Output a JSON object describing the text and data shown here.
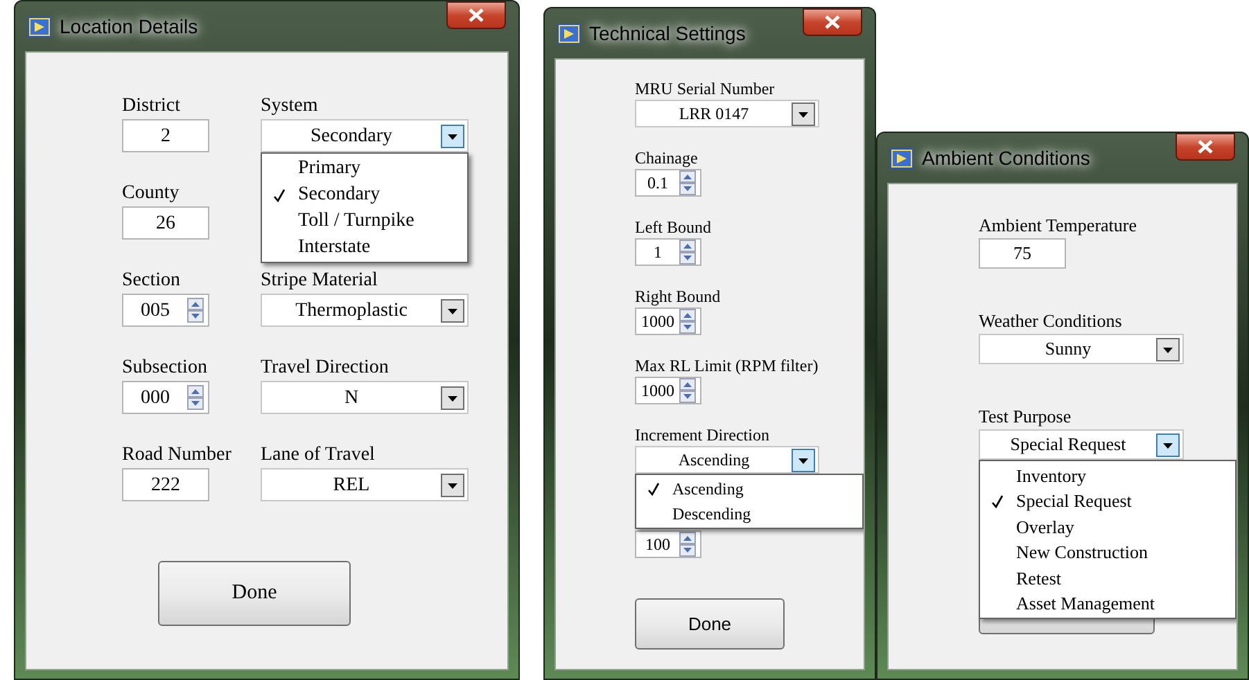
{
  "windows": [
    {
      "title": "Location Details",
      "rows": [
        {
          "left": {
            "kind": "text",
            "label": "District",
            "value": "2"
          },
          "right": {
            "kind": "dropdown",
            "label": "System",
            "value": "Secondary",
            "menu": [
              {
                "label": "Primary",
                "selected": false
              },
              {
                "label": "Secondary",
                "selected": true
              },
              {
                "label": "Toll / Turnpike",
                "selected": false
              },
              {
                "label": "Interstate",
                "selected": false
              }
            ]
          }
        },
        {
          "left": {
            "kind": "text",
            "label": "County",
            "value": "26"
          }
        },
        {
          "left": {
            "kind": "spinner",
            "label": "Section",
            "value": "005"
          },
          "right": {
            "kind": "dropdown",
            "label": "Stripe Material",
            "value": "Thermoplastic"
          }
        },
        {
          "left": {
            "kind": "spinner",
            "label": "Subsection",
            "value": "000"
          },
          "right": {
            "kind": "dropdown",
            "label": "Travel Direction",
            "value": "N"
          }
        },
        {
          "left": {
            "kind": "text",
            "label": "Road Number",
            "value": "222"
          },
          "right": {
            "kind": "dropdown",
            "label": "Lane of Travel",
            "value": "REL"
          }
        }
      ],
      "fields": [
        {
          "kind": "button",
          "label": "Done"
        }
      ]
    },
    {
      "title": "Technical Settings",
      "fields": [
        {
          "kind": "dropdown",
          "label": "MRU Serial Number",
          "value": "LRR 0147"
        },
        {
          "kind": "spinner",
          "label": "Chainage",
          "value": "0.1"
        },
        {
          "kind": "spinner",
          "label": "Left Bound",
          "value": "1"
        },
        {
          "kind": "spinner",
          "label": "Right Bound",
          "value": "1000"
        },
        {
          "kind": "spinner",
          "label": "Max RL Limit (RPM filter)",
          "value": "1000"
        },
        {
          "kind": "dropdown",
          "label": "Increment Direction",
          "value": "Ascending",
          "menu": [
            {
              "label": "Ascending",
              "selected": true
            },
            {
              "label": "Descending",
              "selected": false
            }
          ]
        },
        {
          "kind": "spinner",
          "value": "100"
        },
        {
          "kind": "button",
          "label": "Done"
        }
      ]
    },
    {
      "title": "Ambient Conditions",
      "fields": [
        {
          "kind": "text",
          "label": "Ambient Temperature",
          "value": "75"
        },
        {
          "kind": "dropdown",
          "label": "Weather Conditions",
          "value": "Sunny"
        },
        {
          "kind": "dropdown",
          "label": "Test Purpose",
          "value": "Special Request",
          "menu": [
            {
              "label": "Inventory",
              "selected": false
            },
            {
              "label": "Special Request",
              "selected": true
            },
            {
              "label": "Overlay",
              "selected": false
            },
            {
              "label": "New Construction",
              "selected": false
            },
            {
              "label": "Retest",
              "selected": false
            },
            {
              "label": "Asset Management",
              "selected": false
            }
          ]
        },
        {
          "kind": "button"
        }
      ]
    }
  ]
}
